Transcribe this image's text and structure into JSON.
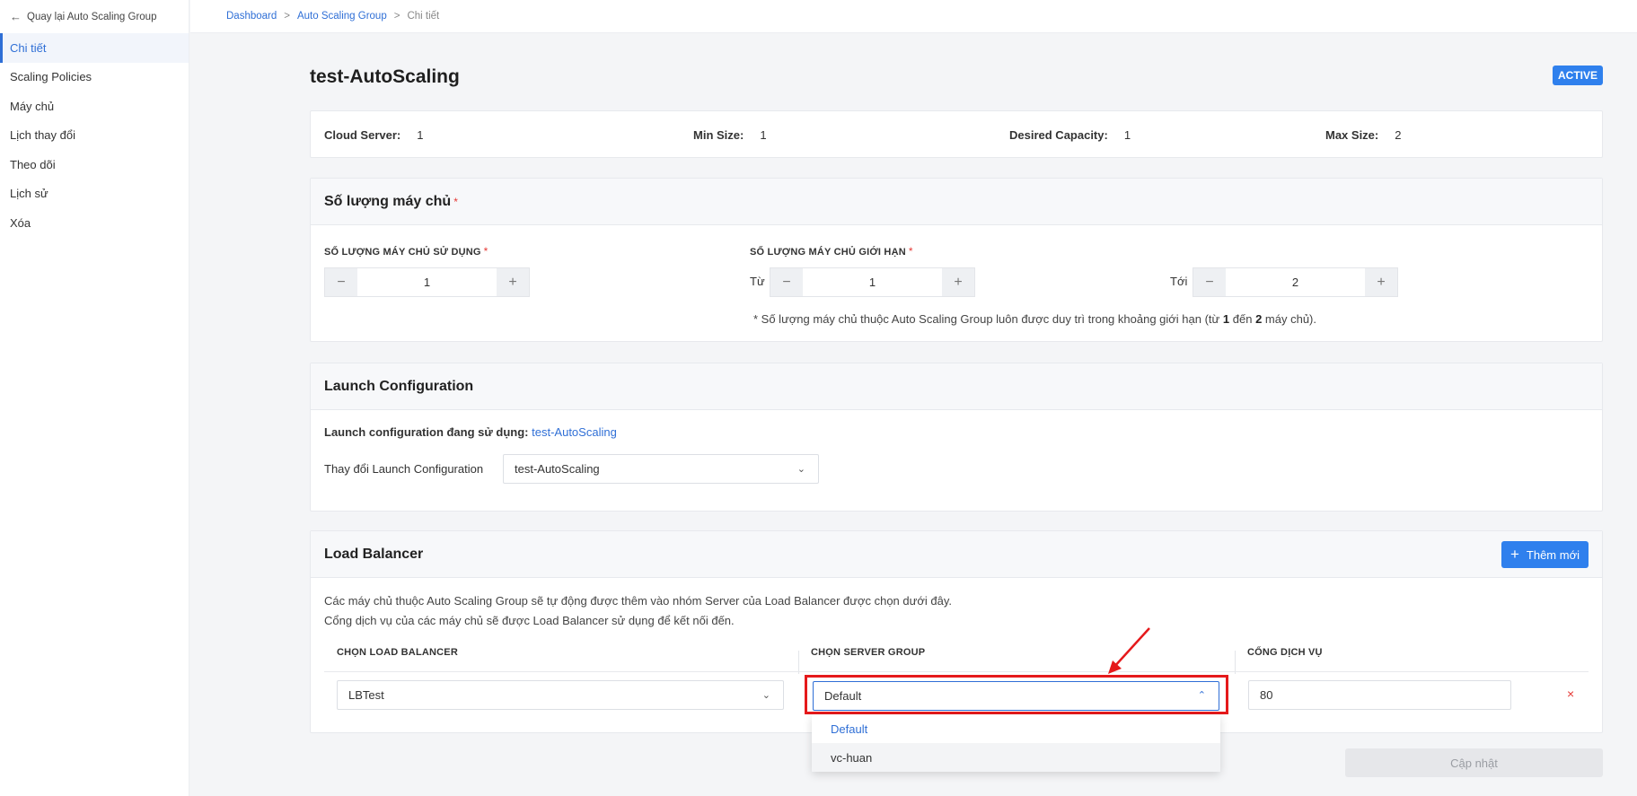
{
  "sidebar": {
    "back_label": "Quay lại Auto Scaling Group",
    "items": [
      {
        "label": "Chi tiết"
      },
      {
        "label": "Scaling Policies"
      },
      {
        "label": "Máy chủ"
      },
      {
        "label": "Lịch thay đổi"
      },
      {
        "label": "Theo dõi"
      },
      {
        "label": "Lịch sử"
      },
      {
        "label": "Xóa"
      }
    ]
  },
  "breadcrumb": {
    "items": [
      "Dashboard",
      "Auto Scaling Group",
      "Chi tiết"
    ],
    "separator": ">"
  },
  "page": {
    "title": "test-AutoScaling",
    "status": "ACTIVE"
  },
  "summary": {
    "cloud_server_label": "Cloud Server:",
    "cloud_server_value": "1",
    "min_size_label": "Min Size:",
    "min_size_value": "1",
    "desired_label": "Desired Capacity:",
    "desired_value": "1",
    "max_size_label": "Max Size:",
    "max_size_value": "2"
  },
  "server_count": {
    "title": "Số lượng máy chủ",
    "required_mark": "*",
    "used_label": "SỐ LƯỢNG MÁY CHỦ SỬ DỤNG",
    "used_value": "1",
    "limit_label": "SỐ LƯỢNG MÁY CHỦ GIỚI HẠN",
    "from_label": "Từ",
    "from_value": "1",
    "to_label": "Tới",
    "to_value": "2",
    "minus": "−",
    "plus": "+",
    "note_prefix": "* Số lượng máy chủ thuộc Auto Scaling Group luôn được duy trì trong khoảng giới hạn (từ",
    "note_from": "1",
    "note_mid": "đến",
    "note_to": "2",
    "note_suffix": "máy chủ)."
  },
  "launch_config": {
    "title": "Launch Configuration",
    "current_label": "Launch configuration đang sử dụng:",
    "current_value": "test-AutoScaling",
    "change_label": "Thay đổi Launch Configuration",
    "selected": "test-AutoScaling"
  },
  "load_balancer": {
    "title": "Load Balancer",
    "add_label": "Thêm mới",
    "desc_line1": "Các máy chủ thuộc Auto Scaling Group sẽ tự động được thêm vào nhóm Server của Load Balancer được chọn dưới đây.",
    "desc_line2": "Cổng dịch vụ của các máy chủ sẽ được Load Balancer sử dụng để kết nối đến.",
    "col_lb": "CHỌN LOAD BALANCER",
    "col_sg": "CHỌN SERVER GROUP",
    "col_port": "CỔNG DỊCH VỤ",
    "row": {
      "lb": "LBTest",
      "server_group": "Default",
      "port": "80"
    },
    "dropdown_options": [
      "Default",
      "vc-huan"
    ],
    "remove_icon": "×"
  },
  "footer": {
    "update_label": "Cập nhật"
  },
  "colors": {
    "accent": "#2f80ed",
    "link": "#2f6fd6",
    "danger": "#e53935",
    "highlight": "#e5191b"
  }
}
